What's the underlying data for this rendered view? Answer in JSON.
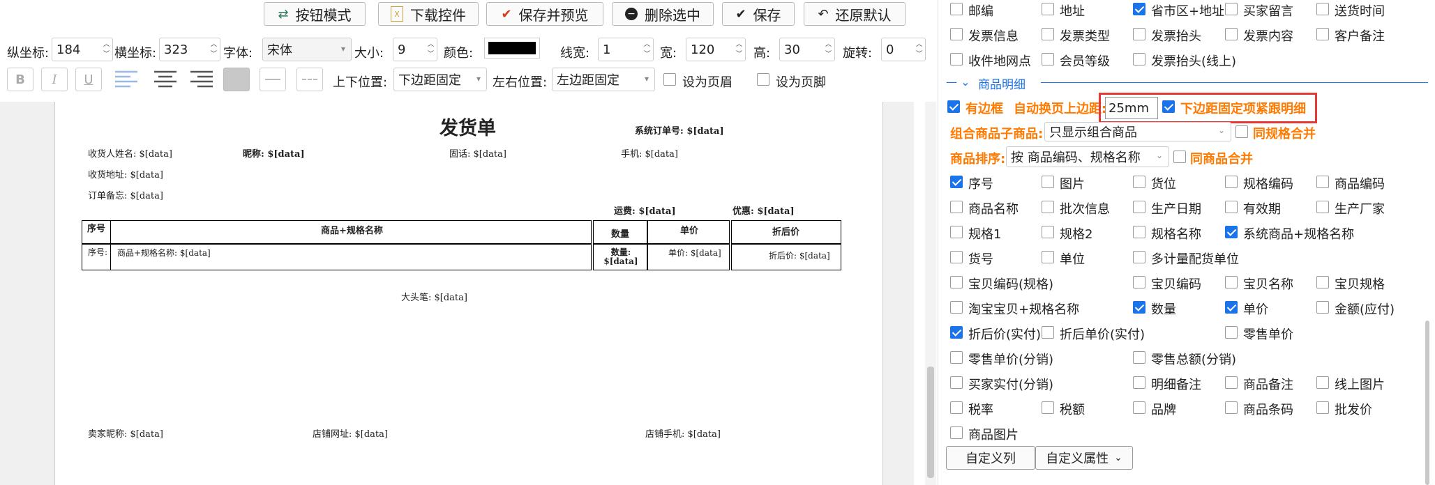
{
  "toolbar": {
    "buttons": [
      {
        "label": "按钮模式",
        "icon": "swap-icon"
      },
      {
        "label": "下载控件",
        "icon": "excel-file-icon"
      },
      {
        "label": "保存并预览",
        "icon": "check-icon"
      },
      {
        "label": "删除选中",
        "icon": "minus-circle-icon"
      },
      {
        "label": "保存",
        "icon": "check-icon"
      },
      {
        "label": "还原默认",
        "icon": "undo-icon"
      }
    ],
    "row2": {
      "y_label": "纵坐标:",
      "y_value": "184",
      "x_label": "横坐标:",
      "x_value": "323",
      "font_label": "字体:",
      "font_value": "宋体",
      "size_label": "大小:",
      "size_value": "9",
      "color_label": "颜色:",
      "color_value": "#000000",
      "line_label": "线宽:",
      "line_value": "1",
      "width_label": "宽:",
      "width_value": "120",
      "height_label": "高:",
      "height_value": "30",
      "rotate_label": "旋转:",
      "rotate_value": "0"
    },
    "row3": {
      "bold": "B",
      "italic": "I",
      "underline": "U",
      "vpos_label": "上下位置:",
      "vpos_value": "下边距固定",
      "hpos_label": "左右位置:",
      "hpos_value": "左边距固定",
      "header_label": "设为页眉",
      "footer_label": "设为页脚"
    }
  },
  "doc": {
    "title": "发货单",
    "order_no": "系统订单号: $[data]",
    "receiver": "收货人姓名: $[data]",
    "nickname": "昵称: $[data]",
    "phone": "固话: $[data]",
    "mobile": "手机: $[data]",
    "address": "收货地址: $[data]",
    "remark": "订单备忘: $[data]",
    "freight": "运费: $[data]",
    "discount": "优惠: $[data]",
    "table_headers": [
      "序号",
      "商品+规格名称",
      "数量",
      "单价",
      "折后价"
    ],
    "table_row": [
      "序号:",
      "商品+规格名称: $[data]",
      "数量: $[data]",
      "单价: $[data]",
      "折后价: $[data]"
    ],
    "big_head": "大头笔: $[data]",
    "seller_nick": "卖家昵称: $[data]",
    "shop_url": "店铺网址: $[data]",
    "shop_mobile": "店铺手机: $[data]"
  },
  "right": {
    "top_rows": [
      [
        {
          "label": "邮编",
          "checked": false
        },
        {
          "label": "地址",
          "checked": false
        },
        {
          "label": "省市区+地址",
          "checked": true
        },
        {
          "label": "买家留言",
          "checked": false
        },
        {
          "label": "送货时间",
          "checked": false
        }
      ],
      [
        {
          "label": "发票信息",
          "checked": false
        },
        {
          "label": "发票类型",
          "checked": false
        },
        {
          "label": "发票抬头",
          "checked": false
        },
        {
          "label": "发票内容",
          "checked": false
        },
        {
          "label": "客户备注",
          "checked": false
        }
      ],
      [
        {
          "label": "收件地网点",
          "checked": false
        },
        {
          "label": "会员等级",
          "checked": false
        },
        {
          "label": "发票抬头(线上)",
          "checked": false
        }
      ]
    ],
    "section_title": "商品明细",
    "has_border": "有边框",
    "auto_margin_label": "自动换页上边距:",
    "auto_margin_value": "25mm",
    "fixed_label": "下边距固定项紧跟明细",
    "combo_label": "组合商品子商品:",
    "combo_value": "只显示组合商品",
    "same_spec_merge": "同规格合并",
    "sort_label": "商品排序:",
    "sort_value": "按 商品编码、规格名称",
    "same_product_merge": "同商品合并",
    "fields": [
      {
        "label": "序号",
        "checked": true
      },
      {
        "label": "图片",
        "checked": false
      },
      {
        "label": "货位",
        "checked": false
      },
      {
        "label": "规格编码",
        "checked": false
      },
      {
        "label": "商品编码",
        "checked": false
      },
      {
        "label": "商品名称",
        "checked": false
      },
      {
        "label": "批次信息",
        "checked": false
      },
      {
        "label": "生产日期",
        "checked": false
      },
      {
        "label": "有效期",
        "checked": false
      },
      {
        "label": "生产厂家",
        "checked": false
      },
      {
        "label": "规格1",
        "checked": false
      },
      {
        "label": "规格2",
        "checked": false
      },
      {
        "label": "规格名称",
        "checked": false
      },
      {
        "label": "系统商品+规格名称",
        "checked": true
      },
      {
        "label": "货号",
        "checked": false
      },
      {
        "label": "单位",
        "checked": false
      },
      {
        "label": "多计量配货单位",
        "checked": false
      },
      {
        "label": "宝贝编码(规格)",
        "checked": false
      },
      {
        "label": "宝贝编码",
        "checked": false
      },
      {
        "label": "宝贝名称",
        "checked": false
      },
      {
        "label": "宝贝规格",
        "checked": false
      },
      {
        "label": "淘宝宝贝+规格名称",
        "checked": false
      },
      {
        "label": "数量",
        "checked": true
      },
      {
        "label": "单价",
        "checked": true
      },
      {
        "label": "金额(应付)",
        "checked": false
      },
      {
        "label": "折后价(实付)",
        "checked": true
      },
      {
        "label": "折后单价(实付)",
        "checked": false
      },
      {
        "label": "零售单价",
        "checked": false
      },
      {
        "label": "零售单价(分销)",
        "checked": false
      },
      {
        "label": "零售总额(分销)",
        "checked": false
      },
      {
        "label": "买家实付(分销)",
        "checked": false
      },
      {
        "label": "明细备注",
        "checked": false
      },
      {
        "label": "商品备注",
        "checked": false
      },
      {
        "label": "线上图片",
        "checked": false
      },
      {
        "label": "税率",
        "checked": false
      },
      {
        "label": "税额",
        "checked": false
      },
      {
        "label": "品牌",
        "checked": false
      },
      {
        "label": "商品条码",
        "checked": false
      },
      {
        "label": "批发价",
        "checked": false
      },
      {
        "label": "商品图片",
        "checked": false
      }
    ],
    "custom_col": "自定义列",
    "custom_attr": "自定义属性"
  }
}
